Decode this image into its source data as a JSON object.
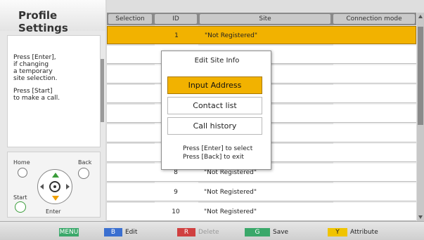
{
  "left_panel": {
    "title": "Profile Settings",
    "help_lines": [
      "Press [Enter],\nif changing\na temporary\nsite selection.",
      "Press [Start]\nto make a call."
    ],
    "remote": {
      "home_label": "Home",
      "back_label": "Back",
      "start_label": "Start",
      "enter_label": "Enter"
    }
  },
  "table": {
    "headers": [
      "Selection",
      "ID",
      "Site",
      "Connection mode"
    ],
    "rows": [
      {
        "selection": "",
        "id": "1",
        "site": "\"Not Registered\"",
        "mode": "",
        "selected": true
      },
      {
        "selection": "",
        "id": "",
        "site": "",
        "mode": ""
      },
      {
        "selection": "",
        "id": "",
        "site": "",
        "mode": ""
      },
      {
        "selection": "",
        "id": "",
        "site": "",
        "mode": ""
      },
      {
        "selection": "",
        "id": "",
        "site": "",
        "mode": ""
      },
      {
        "selection": "",
        "id": "",
        "site": "",
        "mode": ""
      },
      {
        "selection": "",
        "id": "",
        "site": "",
        "mode": ""
      },
      {
        "selection": "",
        "id": "8",
        "site": "\"Not Registered\"",
        "mode": ""
      },
      {
        "selection": "",
        "id": "9",
        "site": "\"Not Registered\"",
        "mode": ""
      },
      {
        "selection": "",
        "id": "10",
        "site": "\"Not Registered\"",
        "mode": ""
      }
    ]
  },
  "popup": {
    "title": "Edit Site Info",
    "options": [
      "Input Address",
      "Contact list",
      "Call history"
    ],
    "help": [
      "Press [Enter] to select",
      "Press [Back] to exit"
    ]
  },
  "bottom_bar": {
    "keys": [
      {
        "key": "MENU",
        "label": "",
        "color": "#3aa86a"
      },
      {
        "key": "B",
        "label": "Edit",
        "color": "#3a6fd0"
      },
      {
        "key": "R",
        "label": "Delete",
        "color": "#d04040",
        "disabled": true
      },
      {
        "key": "G",
        "label": "Save",
        "color": "#3aa86a"
      },
      {
        "key": "Y",
        "label": "Attribute",
        "color": "#f0c400"
      }
    ]
  }
}
